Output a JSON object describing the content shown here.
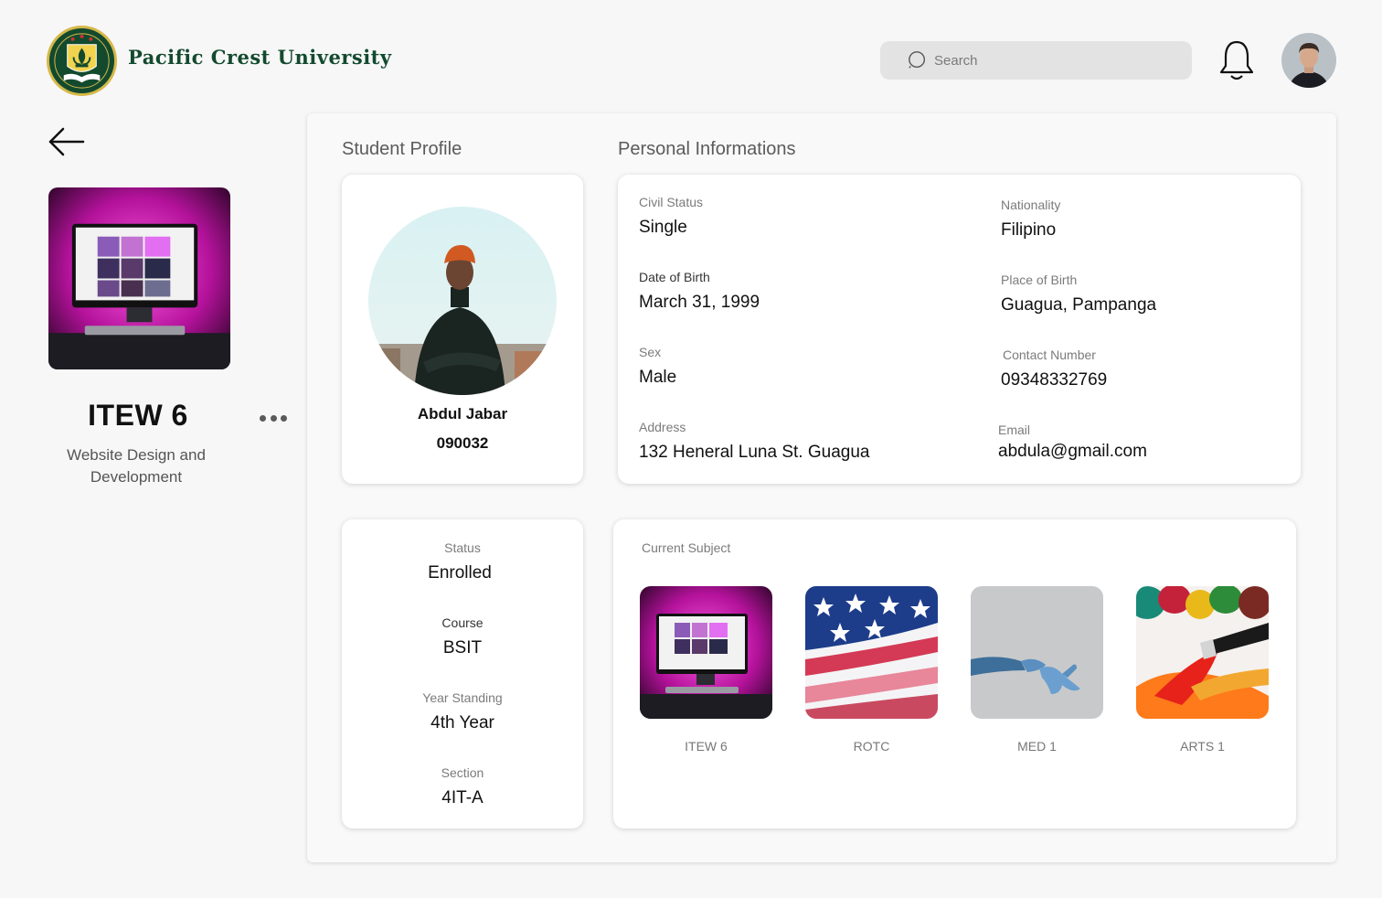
{
  "header": {
    "brand": "Pacific Crest University",
    "search_placeholder": "Search"
  },
  "course": {
    "code": "ITEW 6",
    "name": "Website Design and Development"
  },
  "sections": {
    "student_profile": "Student Profile",
    "personal_informations": "Personal Informations",
    "current_subject": "Current Subject"
  },
  "student": {
    "name": "Abdul Jabar",
    "id": "090032"
  },
  "personal": {
    "civil_status_label": "Civil Status",
    "civil_status": "Single",
    "nationality_label": "Nationality",
    "nationality": "Filipino",
    "dob_label": "Date of Birth",
    "dob": "March 31, 1999",
    "pob_label": "Place of Birth",
    "pob": "Guagua, Pampanga",
    "sex_label": "Sex",
    "sex": "Male",
    "contact_label": "Contact Number",
    "contact": "09348332769",
    "address_label": "Address",
    "address": "132 Heneral Luna St. Guagua",
    "email_label": "Email",
    "email": "abdula@gmail.com"
  },
  "enrollment": {
    "status_label": "Status",
    "status": "Enrolled",
    "course_label": "Course",
    "course": "BSIT",
    "year_label": "Year Standing",
    "year": "4th Year",
    "section_label": "Section",
    "section": "4IT-A"
  },
  "subjects": [
    {
      "label": "ITEW 6"
    },
    {
      "label": "ROTC"
    },
    {
      "label": "MED 1"
    },
    {
      "label": "ARTS 1"
    }
  ],
  "colors": {
    "brand_green": "#134a2e",
    "accent_magenta": "#e024c8",
    "background": "#f7f7f7"
  }
}
